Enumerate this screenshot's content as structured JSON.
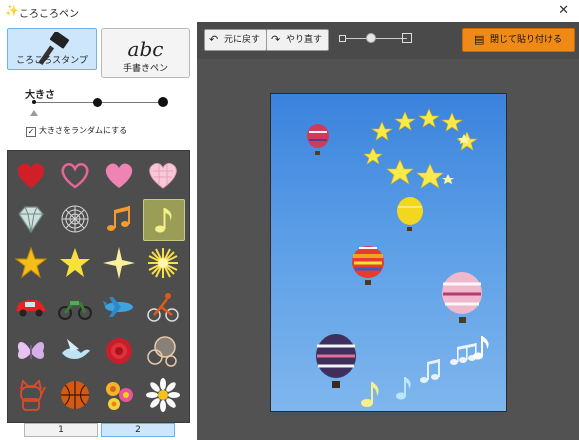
{
  "window": {
    "title": "ころころペン",
    "close_icon": "close-icon"
  },
  "mode_buttons": {
    "stamp_label": "ころころスタンプ",
    "pen_label": "手書きペン",
    "pen_glyph": "abc"
  },
  "size": {
    "label": "大きさ",
    "options": [
      "small",
      "medium",
      "large"
    ],
    "selected_index": 0
  },
  "random_size": {
    "label": "大きさをランダムにする",
    "checked": true
  },
  "stamps": {
    "icons": [
      "red-heart-icon",
      "pink-outline-heart-icon",
      "pink-heart-icon",
      "plaid-heart-icon",
      "diamond-icon",
      "spiderweb-icon",
      "orange-music-notes-icon",
      "yellow-music-note-icon",
      "gold-star-icon",
      "yellow-star-icon",
      "sparkle-icon",
      "burst-icon",
      "red-car-icon",
      "motorcycle-icon",
      "airplane-icon",
      "cyclist-icon",
      "butterfly-icon",
      "bird-icon",
      "red-rose-icon",
      "bubbles-icon",
      "lucky-cat-icon",
      "basketball-icon",
      "flowers-icon",
      "daisy-icon"
    ],
    "selected_index": 7
  },
  "pager": {
    "pages": [
      "1",
      "2"
    ],
    "active_index": 1
  },
  "toolbar": {
    "undo_label": "元に戻す",
    "redo_label": "やり直す",
    "close_paste_label": "閉じて貼り付ける"
  },
  "colors": {
    "accent": "#f08a17",
    "selection": "#cde6fb",
    "dark_panel": "#525252"
  }
}
